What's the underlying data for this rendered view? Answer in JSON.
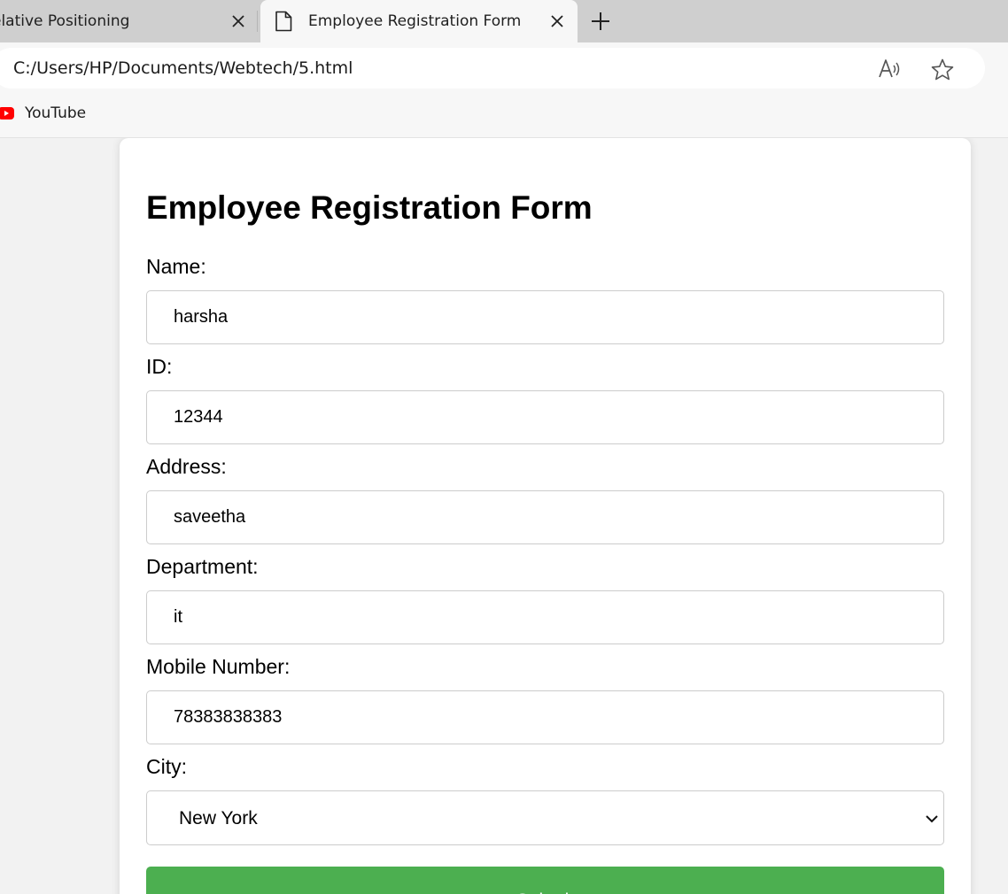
{
  "browser": {
    "tabs": [
      {
        "title": "elative Positioning",
        "active": false
      },
      {
        "title": "Employee Registration Form",
        "active": true
      }
    ],
    "url": "C:/Users/HP/Documents/Webtech/5.html",
    "bookmarks": [
      {
        "label": "YouTube",
        "icon": "youtube-icon"
      }
    ]
  },
  "form": {
    "title": "Employee Registration Form",
    "fields": [
      {
        "label": "Name:",
        "value": "harsha"
      },
      {
        "label": "ID:",
        "value": "12344"
      },
      {
        "label": "Address:",
        "value": "saveetha"
      },
      {
        "label": "Department:",
        "value": "it"
      },
      {
        "label": "Mobile Number:",
        "value": "78383838383"
      }
    ],
    "city": {
      "label": "City:",
      "selected": "New York"
    },
    "submit_label": "Submit"
  },
  "colors": {
    "submit_bg": "#4caf50",
    "youtube_red": "#ff0000",
    "tabstrip_bg": "#cfcfcf"
  }
}
